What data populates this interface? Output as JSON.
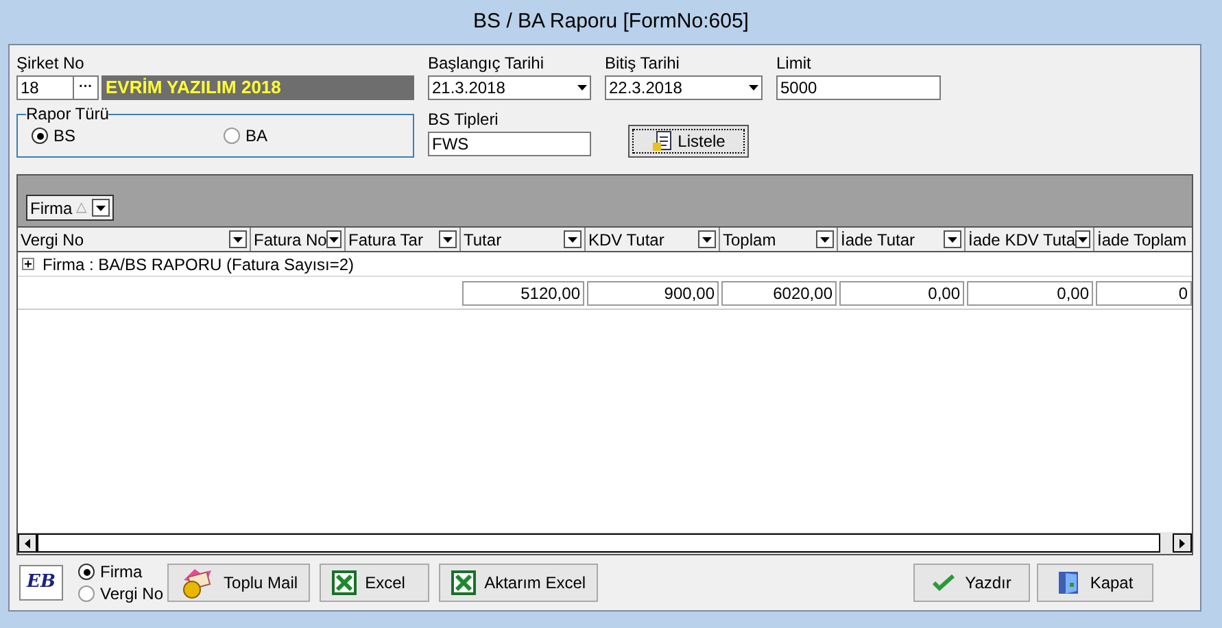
{
  "window": {
    "title": "BS / BA Raporu [FormNo:605]"
  },
  "form": {
    "company_no_label": "Şirket No",
    "company_no": "18",
    "lookup_button": "···",
    "company_name": "EVRİM YAZILIM 2018",
    "start_date_label": "Başlangıç Tarihi",
    "start_date": "21.3.2018",
    "end_date_label": "Bitiş Tarihi",
    "end_date": "22.3.2018",
    "limit_label": "Limit",
    "limit": "5000",
    "report_type": {
      "legend": "Rapor Türü",
      "options": [
        {
          "label": "BS",
          "selected": true
        },
        {
          "label": "BA",
          "selected": false
        }
      ]
    },
    "bs_types_label": "BS Tipleri",
    "bs_types": "FWS",
    "list_button": "Listele"
  },
  "grid": {
    "group_chip": "Firma",
    "group_chip_sort": "△",
    "columns": [
      {
        "label": "Vergi No",
        "filter": true
      },
      {
        "label": "Fatura No",
        "filter": true
      },
      {
        "label": "Fatura Tar",
        "filter": true
      },
      {
        "label": "Tutar",
        "filter": true,
        "total": "5120,00"
      },
      {
        "label": "KDV Tutar",
        "filter": true,
        "total": "900,00"
      },
      {
        "label": "Toplam",
        "filter": true,
        "total": "6020,00"
      },
      {
        "label": "İade Tutar",
        "filter": true,
        "total": "0,00"
      },
      {
        "label": "İade KDV Tuta",
        "filter": true,
        "total": "0,00"
      },
      {
        "label": "İade Toplam",
        "filter": false,
        "total": "0"
      }
    ],
    "group_row": {
      "expanded": false,
      "label": "Firma : BA/BS RAPORU (Fatura Sayısı=2)"
    }
  },
  "footer": {
    "logo": "EB",
    "group_by": [
      {
        "label": "Firma",
        "selected": true
      },
      {
        "label": "Vergi No",
        "selected": false
      }
    ],
    "buttons": [
      {
        "kind": "mail",
        "label": "Toplu Mail"
      },
      {
        "kind": "excel",
        "label": "Excel"
      },
      {
        "kind": "excel",
        "label": "Aktarım Excel"
      }
    ],
    "right_buttons": [
      {
        "kind": "check",
        "label": "Yazdır"
      },
      {
        "kind": "door",
        "label": "Kapat"
      }
    ]
  }
}
